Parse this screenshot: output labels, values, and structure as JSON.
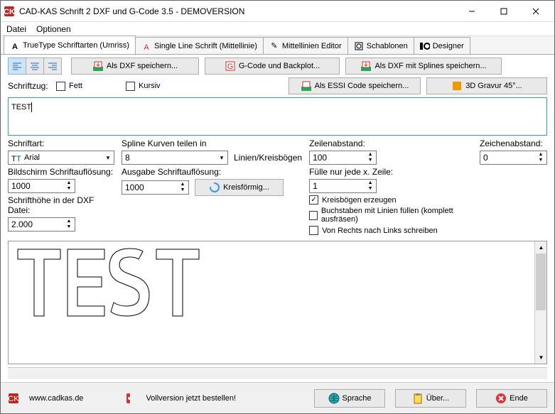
{
  "title": "CAD-KAS Schrift 2 DXF und G-Code 3.5 - DEMOVERSION",
  "menu": {
    "file": "Datei",
    "options": "Optionen"
  },
  "tabs": {
    "truetype": "TrueType Schriftarten (Umriss)",
    "singleline": "Single Line Schrift (Mittellinie)",
    "editor": "Mittellinien Editor",
    "templates": "Schablonen",
    "designer": "Designer"
  },
  "btns": {
    "savedxf": "Als DXF speichern...",
    "gcode": "G-Code und Backplot...",
    "savespline": "Als DXF mit Splines speichern...",
    "saveessi": "Als ESSI Code speichern...",
    "gravur": "3D Gravur 45°...",
    "circular": "Kreisförmig..."
  },
  "labels": {
    "schriftzug": "Schriftzug:",
    "fett": "Fett",
    "kursiv": "Kursiv",
    "schriftart": "Schriftart:",
    "spline": "Spline Kurven teilen in",
    "linienkreis": "Linien/Kreisbögen",
    "zeilenabstand": "Zeilenabstand:",
    "zeichenabstand": "Zeichenabstand:",
    "bildschirm": "Bildschirm Schriftauflösung:",
    "ausgabe": "Ausgabe Schriftauflösung:",
    "fuelle": "Fülle nur jede x. Zeile:",
    "schrifthoehe": "Schrifthöhe in der DXF Datei:",
    "kreisbogen": "Kreisbögen erzeugen",
    "buchstaben": "Buchstaben mit Linien füllen (komplett ausfräsen)",
    "vonrechts": "Von Rechts nach Links schreiben"
  },
  "values": {
    "textinput": "TEST",
    "font": "Arial",
    "splinediv": "8",
    "zeilenabstand": "100",
    "zeichenabstand": "0",
    "bildschirm": "1000",
    "ausgabe": "1000",
    "fuelle": "1",
    "schrifthoehe": "2.000"
  },
  "footer": {
    "url": "www.cadkas.de",
    "order": "Vollversion jetzt bestellen!",
    "language": "Sprache",
    "about": "Über...",
    "end": "Ende"
  }
}
